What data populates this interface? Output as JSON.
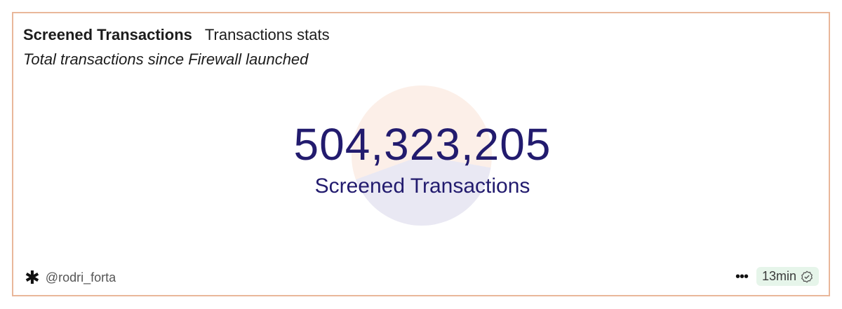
{
  "header": {
    "title": "Screened Transactions",
    "tab": "Transactions stats",
    "description": "Total transactions since Firewall launched"
  },
  "metric": {
    "value": "504,323,205",
    "label": "Screened Transactions"
  },
  "footer": {
    "author": "@rodri_forta",
    "star_icon": "✱",
    "more_icon": "•••",
    "time": "13min"
  },
  "colors": {
    "border": "#e9b79a",
    "number": "#221b6e",
    "badge_bg": "#e6f5ea"
  }
}
